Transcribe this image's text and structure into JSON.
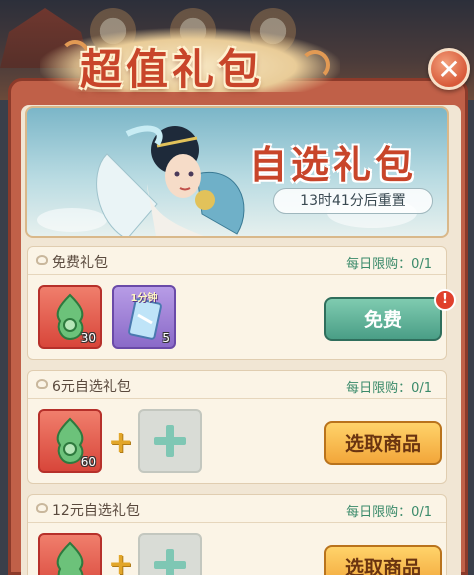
{
  "popup": {
    "title": "超值礼包",
    "close_label": "✕"
  },
  "banner": {
    "title": "自选礼包",
    "reset_text": "13时41分后重置"
  },
  "packs": [
    {
      "name": "免费礼包",
      "limit": "每日限购：0/1",
      "items": [
        {
          "icon": "jade-ornament-icon",
          "qty": "30"
        },
        {
          "icon": "speedup-card-icon",
          "tag": "1分钟",
          "qty": "5"
        }
      ],
      "button": "免费",
      "badge": "!"
    },
    {
      "name": "6元自选礼包",
      "limit": "每日限购：0/1",
      "items": [
        {
          "icon": "jade-ornament-icon",
          "qty": "60"
        }
      ],
      "plus": "+",
      "button": "选取商品"
    },
    {
      "name": "12元自选礼包",
      "limit": "每日限购：0/1",
      "plus": "+",
      "button": "选取商品"
    }
  ],
  "colors": {
    "frame": "#c06048",
    "title_red": "#c8452a",
    "free_button": "#4a9e86",
    "select_button": "#f2a63a"
  }
}
